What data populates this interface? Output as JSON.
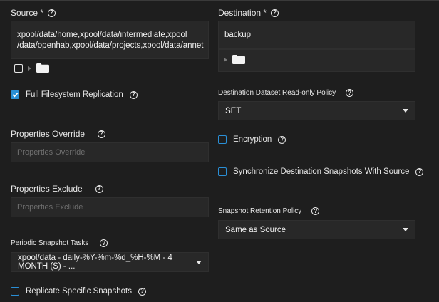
{
  "source": {
    "label": "Source *",
    "lines": [
      "xpool/data/home,xpool/data/intermediate,xpool",
      "/data/openhab,xpool/data/projects,xpool/data/annet"
    ]
  },
  "destination": {
    "label": "Destination *",
    "value": "backup"
  },
  "full_filesystem_replication": {
    "label": "Full Filesystem Replication",
    "checked": true
  },
  "destination_readonly_policy": {
    "label": "Destination Dataset Read-only Policy",
    "value": "SET"
  },
  "properties_override": {
    "label": "Properties Override",
    "placeholder": "Properties Override"
  },
  "encryption": {
    "label": "Encryption",
    "checked": false
  },
  "sync_destination_snapshots": {
    "label": "Synchronize Destination Snapshots With Source",
    "checked": false
  },
  "properties_exclude": {
    "label": "Properties Exclude",
    "placeholder": "Properties Exclude"
  },
  "snapshot_retention_policy": {
    "label": "Snapshot Retention Policy",
    "value": "Same as Source"
  },
  "periodic_snapshot_tasks": {
    "label": "Periodic Snapshot Tasks",
    "value": "xpool/data - daily-%Y-%m-%d_%H-%M - 4 MONTH (S) - ..."
  },
  "replicate_specific_snapshots": {
    "label": "Replicate Specific Snapshots",
    "checked": false
  },
  "colors": {
    "accent": "#2a8fd6",
    "background": "#1e1e1e",
    "field": "#282828"
  }
}
